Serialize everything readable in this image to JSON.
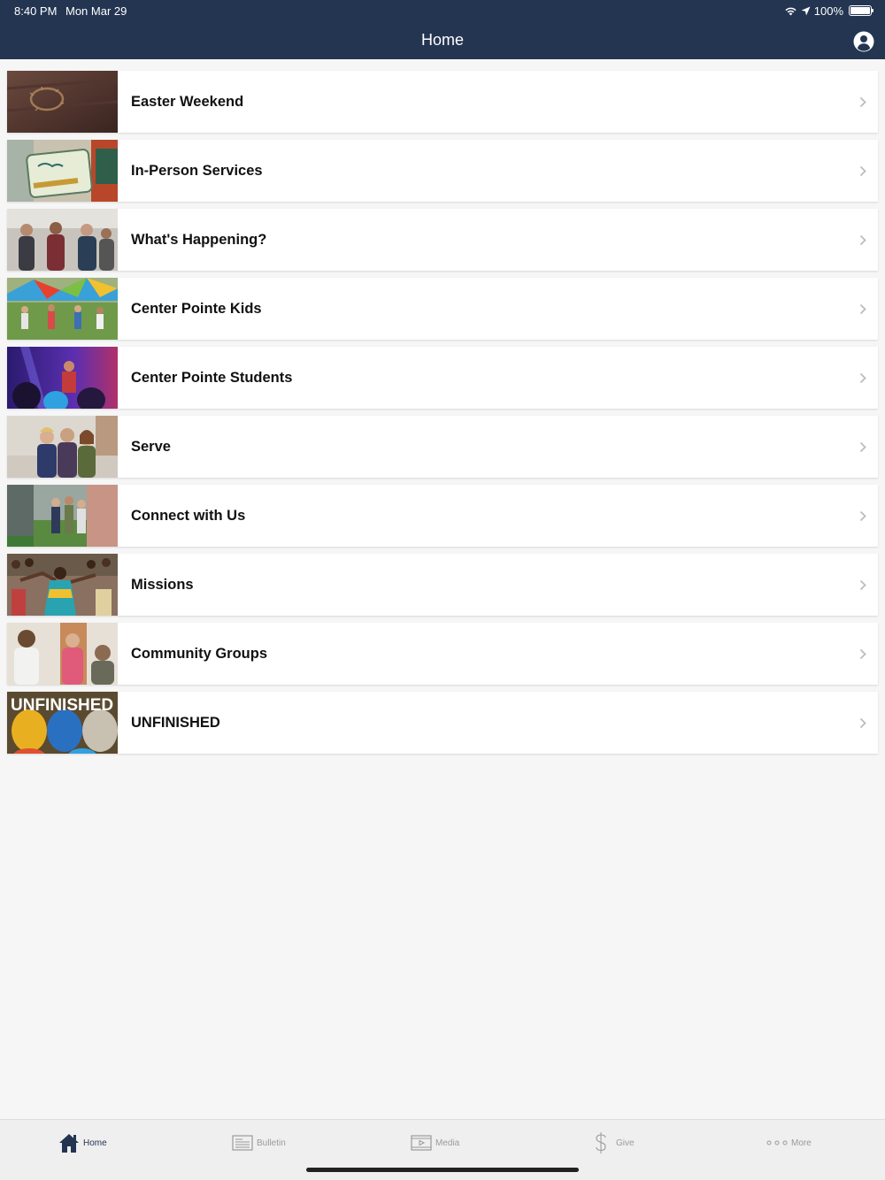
{
  "status_bar": {
    "time": "8:40 PM",
    "date": "Mon Mar 29",
    "battery": "100%",
    "icons": [
      "wifi-icon",
      "location-arrow-icon",
      "battery-icon"
    ]
  },
  "nav": {
    "title": "Home",
    "profile_icon": "user-circle-icon"
  },
  "list": {
    "items": [
      {
        "label": "Easter Weekend",
        "image": "crown-of-thorns-photo"
      },
      {
        "label": "In-Person Services",
        "image": "come-in-were-open-sign-photo"
      },
      {
        "label": "What's Happening?",
        "image": "people-talking-photo"
      },
      {
        "label": "Center Pointe Kids",
        "image": "kids-parachute-photo"
      },
      {
        "label": "Center Pointe Students",
        "image": "students-worship-photo"
      },
      {
        "label": "Serve",
        "image": "volunteers-photo"
      },
      {
        "label": "Connect with Us",
        "image": "people-walking-photo"
      },
      {
        "label": "Missions",
        "image": "missions-celebration-photo"
      },
      {
        "label": "Community Groups",
        "image": "group-laughing-photo"
      },
      {
        "label": "UNFINISHED",
        "image": "hard-hats-photo",
        "image_text": "UNFINISHED"
      }
    ]
  },
  "tabbar": {
    "tabs": [
      {
        "label": "Home",
        "icon": "home-icon",
        "active": true
      },
      {
        "label": "Bulletin",
        "icon": "bulletin-icon",
        "active": false
      },
      {
        "label": "Media",
        "icon": "media-icon",
        "active": false
      },
      {
        "label": "Give",
        "icon": "dollar-icon",
        "active": false
      },
      {
        "label": "More",
        "icon": "more-dots-icon",
        "active": false
      }
    ]
  },
  "colors": {
    "header_bg": "#243552",
    "page_bg": "#f6f6f6",
    "tab_active": "#243552",
    "tab_inactive": "#9a9a9a"
  }
}
